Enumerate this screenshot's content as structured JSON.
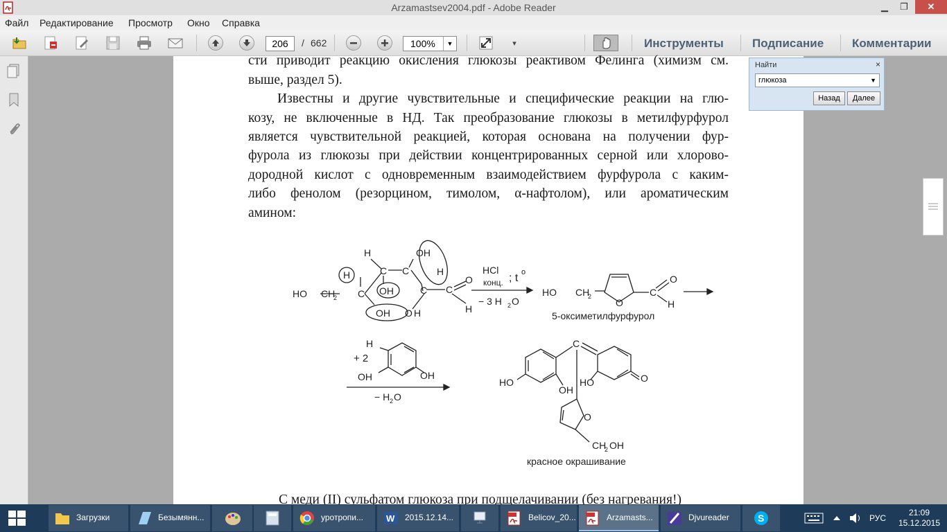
{
  "window": {
    "title": "Arzamastsev2004.pdf - Adobe Reader",
    "minimize_glyph": "▁",
    "restore_glyph": "❐",
    "close_glyph": "✕"
  },
  "menu": [
    "Файл",
    "Редактирование",
    "Просмотр",
    "Окно",
    "Справка"
  ],
  "toolbar": {
    "page_current": "206",
    "page_separator": "/",
    "page_total": "662",
    "zoom": "100%",
    "tools_label": "Инструменты",
    "sign_label": "Подписание",
    "comment_label": "Комментарии"
  },
  "find": {
    "label": "Найти",
    "close": "×",
    "query": "глюкоза",
    "back": "Назад",
    "next": "Далее"
  },
  "document": {
    "lines": [
      "сти приводит реакцию окисления глюкозы реактивом Фелинга (химизм см.",
      "выше, раздел 5).",
      "Известны и другие чувствительные и специфические реакции на глю-",
      "козу, не включенные в НД. Так преобразование глюкозы в метилфурфурол",
      "является чувствительной реакцией, которая основана на получении фур-",
      "фурола из глюкозы при действии концентрированных серной или хлорово-",
      "дородной кислот с одновременным взаимодействием фурфурола с каким-",
      "либо фенолом (резорцином, тимолом, α-нафтолом), или ароматическим",
      "амином:"
    ],
    "bottom_line": "С меди (II) сульфатом глюкоза при подщелачивании (без нагревания!)",
    "scheme": {
      "glucose_ho": "HO",
      "glucose_ch": "CH",
      "glucose_ch_sub": "2",
      "c": "C",
      "o": "O",
      "h": "H",
      "oh": "OH",
      "reagent1": "HCl",
      "reagent1_b": "конц.",
      "reagent1_c": "; t",
      "reagent1_deg": "o",
      "minus3h2o": "− 3 H",
      "h2o_sub": "2",
      "h2o_o": "O",
      "product1_name": "5-оксиметилфурфурол",
      "plus2": "+ 2",
      "minus_h2o": "− H",
      "product2_name": "красное окрашивание",
      "ch2oh": "CH",
      "ch2oh_tail": "OH"
    }
  },
  "taskbar": {
    "items": [
      {
        "label": "Загрузки"
      },
      {
        "label": "Безымянн..."
      },
      {
        "label": ""
      },
      {
        "label": ""
      },
      {
        "label": "уротропи..."
      },
      {
        "label": "2015.12.14..."
      },
      {
        "label": ""
      },
      {
        "label": "Belicov_20..."
      },
      {
        "label": "Arzamasts..."
      },
      {
        "label": "Djvureader"
      },
      {
        "label": ""
      }
    ],
    "lang": "РУС",
    "time": "21:09",
    "date": "15.12.2015"
  },
  "colors": {
    "accent": "#4d6176",
    "taskbar": "#1e3c5a",
    "close": "#c7504b"
  }
}
